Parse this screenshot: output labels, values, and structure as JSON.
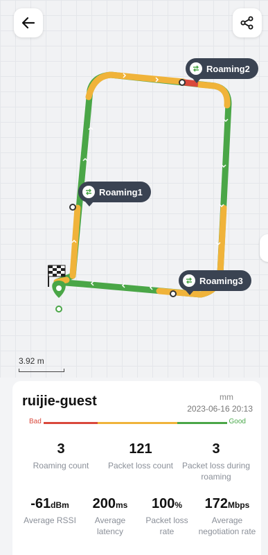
{
  "map": {
    "scale_label": "3.92 m",
    "roaming_points": [
      {
        "label": "Roaming1"
      },
      {
        "label": "Roaming2"
      },
      {
        "label": "Roaming3"
      }
    ],
    "colors": {
      "good": "#4aa647",
      "medium": "#f0b33a",
      "bad": "#d9483b",
      "bubble": "#3a4352"
    }
  },
  "details": {
    "ssid": "ruijie-guest",
    "user": "mm",
    "timestamp": "2023-06-16 20:13",
    "quality_bad": "Bad",
    "quality_good": "Good",
    "row1": [
      {
        "value": "3",
        "label": "Roaming count"
      },
      {
        "value": "121",
        "label": "Packet loss count"
      },
      {
        "value": "3",
        "label": "Packet loss during roaming"
      }
    ],
    "row2": [
      {
        "value": "-61",
        "unit": "dBm",
        "label": "Average RSSI"
      },
      {
        "value": "200",
        "unit": "ms",
        "label": "Average latency"
      },
      {
        "value": "100",
        "unit": "%",
        "label": "Packet loss rate"
      },
      {
        "value": "172",
        "unit": "Mbps",
        "label": "Average negotiation rate"
      }
    ]
  }
}
